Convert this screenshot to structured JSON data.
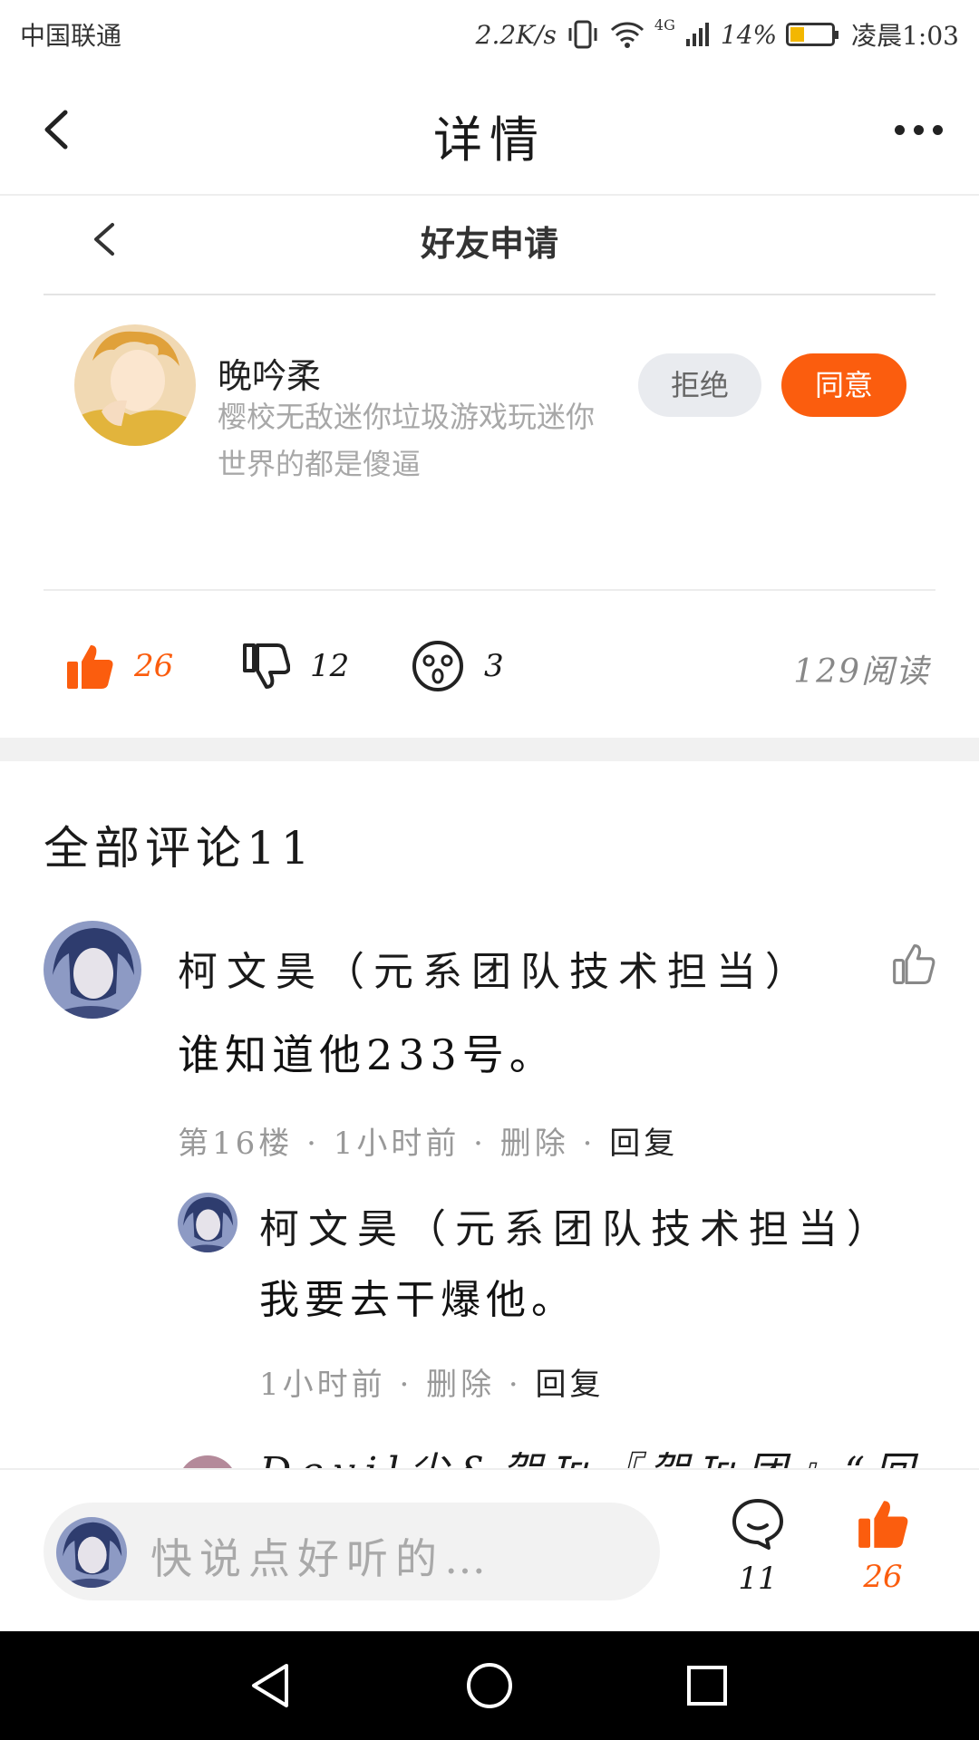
{
  "status_bar": {
    "carrier": "中国联通",
    "net_speed": "2.2K/s",
    "network": "4G",
    "battery": "14%",
    "time": "凌晨1:03"
  },
  "header": {
    "title": "详情"
  },
  "card": {
    "title": "好友申请",
    "requester_name": "晚吟柔",
    "requester_message": "樱校无敌迷你垃圾游戏玩迷你世界的都是傻逼",
    "reject_label": "拒绝",
    "agree_label": "同意"
  },
  "reactions": {
    "likes": "26",
    "dislikes": "12",
    "shocked": "3",
    "reads": "129阅读"
  },
  "comments": {
    "title": "全部评论11",
    "items": [
      {
        "author": "柯文昊（元系团队技术担当）",
        "text": "谁知道他233号。",
        "floor": "第16楼",
        "time": "1小时前",
        "delete": "删除",
        "reply": "回复"
      }
    ],
    "replies": [
      {
        "author": "柯文昊（元系团队技术担当）",
        "text": "我要去干爆他。",
        "time": "1小时前",
        "delete": "删除",
        "reply": "回复"
      },
      {
        "author_partial": "Devil尘&贺℡『贺℡团』“回复"
      }
    ]
  },
  "bottom_bar": {
    "placeholder": "快说点好听的…",
    "comment_count": "11",
    "like_count": "26"
  },
  "colors": {
    "accent": "#fb5d0e",
    "reject_bg": "#e9ebef",
    "muted_text": "#a8a8a8"
  }
}
